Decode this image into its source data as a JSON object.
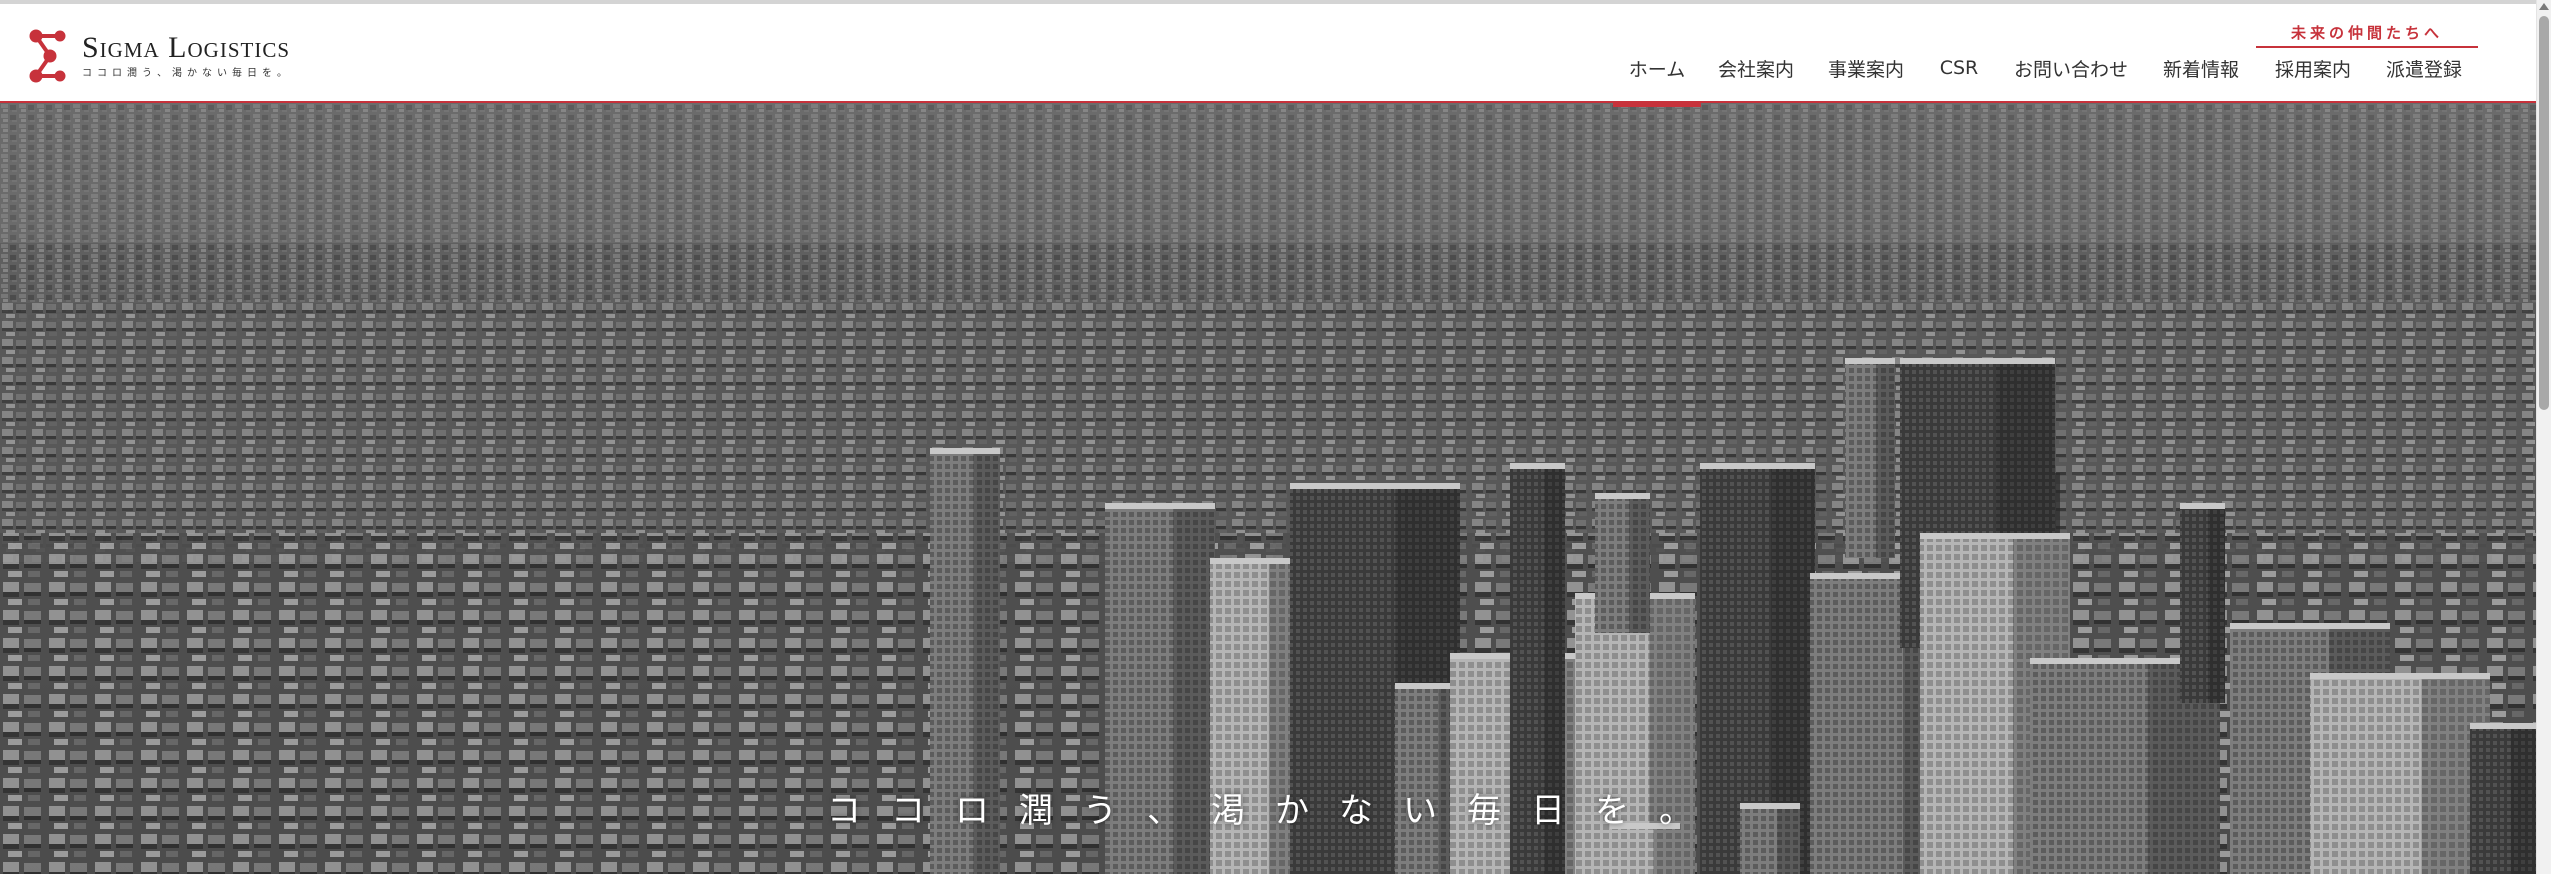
{
  "brand": {
    "name": "Sigma Logistics",
    "tagline": "ココロ潤う、渇かない毎日を。",
    "mark_color": "#c7323b"
  },
  "recruit_link": {
    "label": "未来の仲間たちへ"
  },
  "nav": {
    "active_index": 0,
    "items": [
      {
        "label": "ホーム"
      },
      {
        "label": "会社案内"
      },
      {
        "label": "事業案内"
      },
      {
        "label": "CSR"
      },
      {
        "label": "お問い合わせ"
      },
      {
        "label": "新着情報"
      },
      {
        "label": "採用案内"
      },
      {
        "label": "派遣登録"
      }
    ]
  },
  "hero": {
    "copy": "ココロ潤う、渇かない毎日を。",
    "image": "aerial-city-monochrome"
  },
  "colors": {
    "accent": "#c7323b",
    "text": "#333333"
  }
}
